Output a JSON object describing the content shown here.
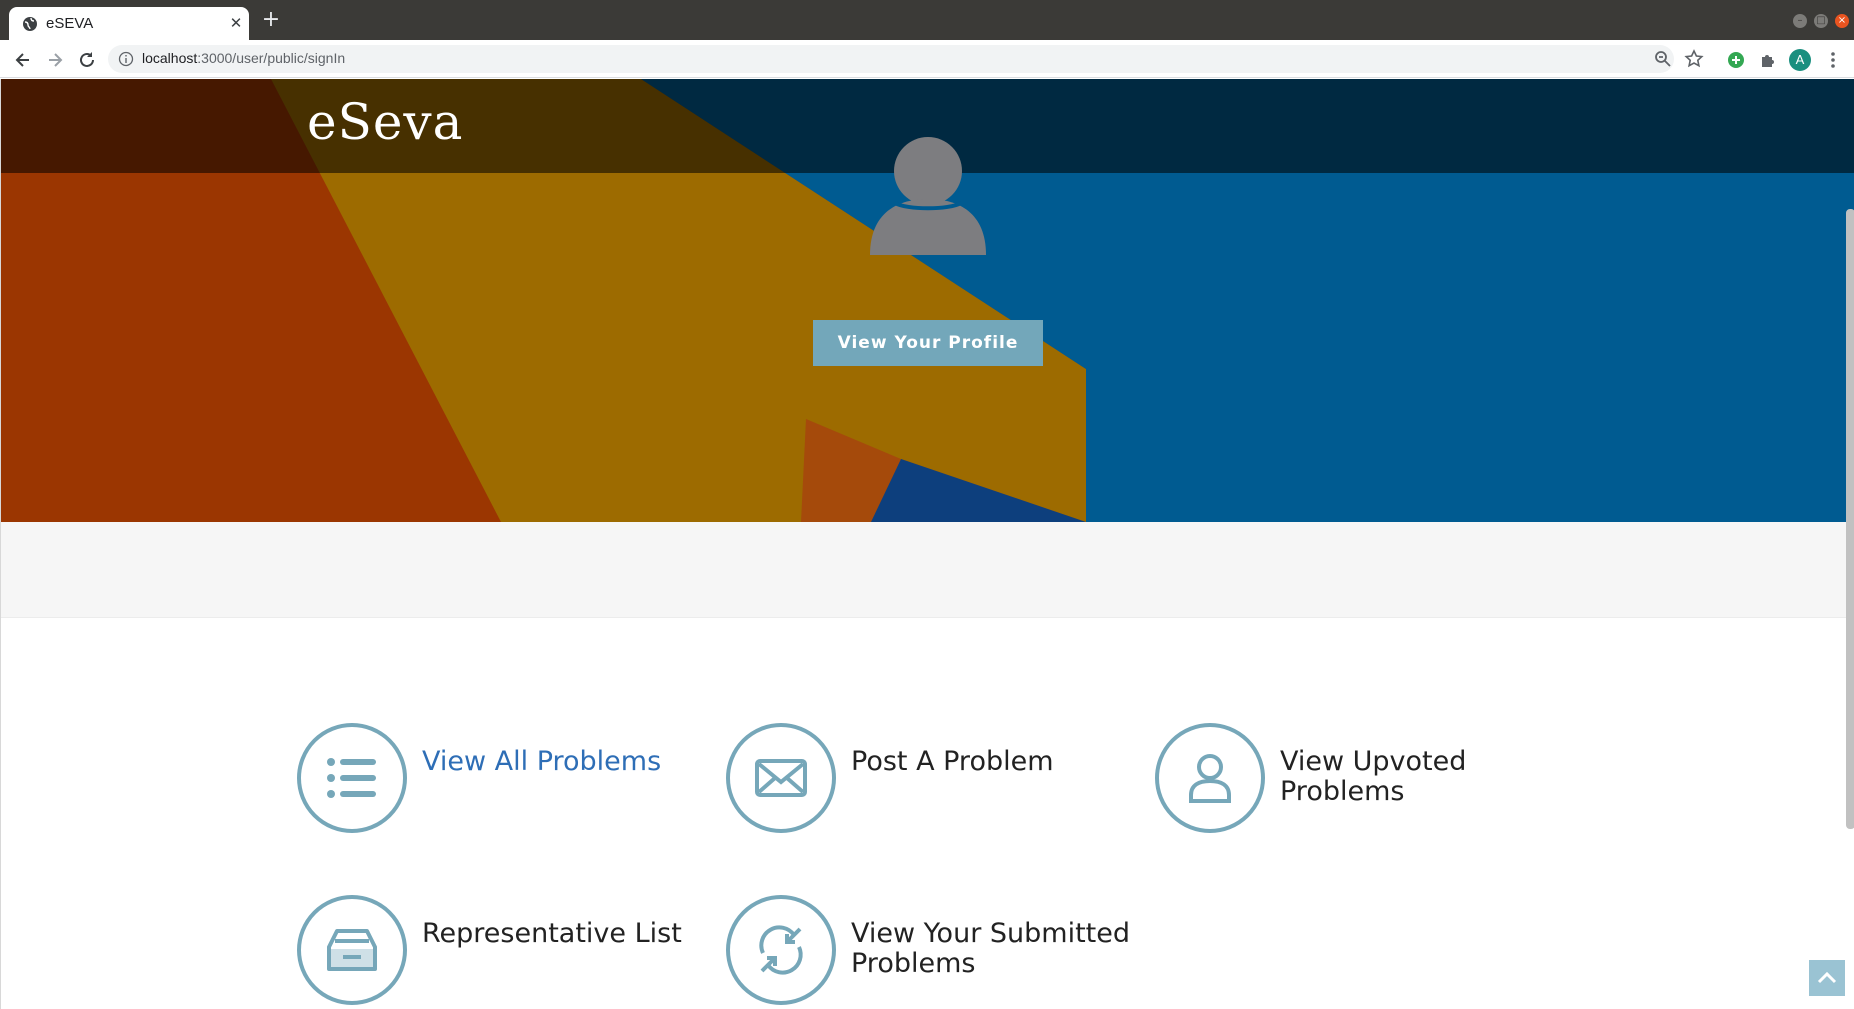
{
  "browser": {
    "tab_title": "eSEVA",
    "tab_close": "✕",
    "new_tab": "+",
    "url_host": "localhost",
    "url_path": ":3000/user/public/signIn",
    "profile_initial": "A"
  },
  "site": {
    "logo": "eSeva",
    "profile_button": "View Your Profile"
  },
  "features": [
    {
      "label_line1": "View All Problems",
      "label_line2": "",
      "icon": "list-icon",
      "style": "link"
    },
    {
      "label_line1": "Post A Problem",
      "label_line2": "",
      "icon": "envelope-icon",
      "style": "text"
    },
    {
      "label_line1": "View Upvoted",
      "label_line2": "Problems",
      "icon": "user-icon",
      "style": "text"
    },
    {
      "label_line1": "Representative List",
      "label_line2": "",
      "icon": "inbox-icon",
      "style": "text"
    },
    {
      "label_line1": "View Your Submitted",
      "label_line2": "Problems",
      "icon": "sync-icon",
      "style": "text"
    }
  ],
  "colors": {
    "accent": "#76a7b9",
    "link": "#2e6eb6",
    "button": "#73a7ba"
  }
}
